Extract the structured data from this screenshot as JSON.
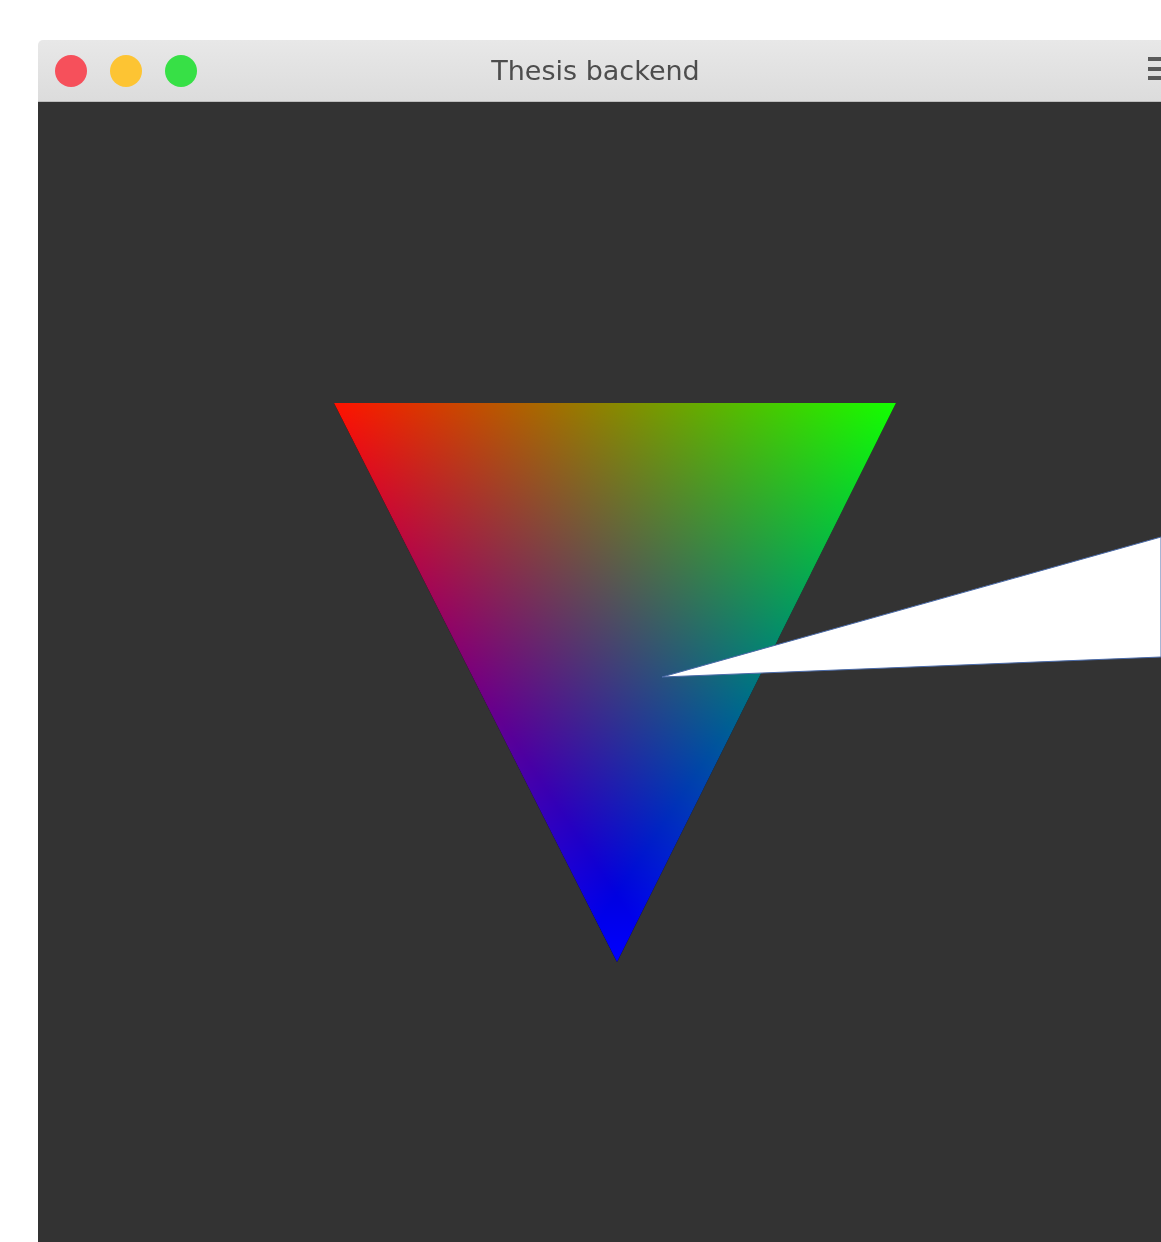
{
  "window": {
    "title": "Thesis backend"
  }
}
